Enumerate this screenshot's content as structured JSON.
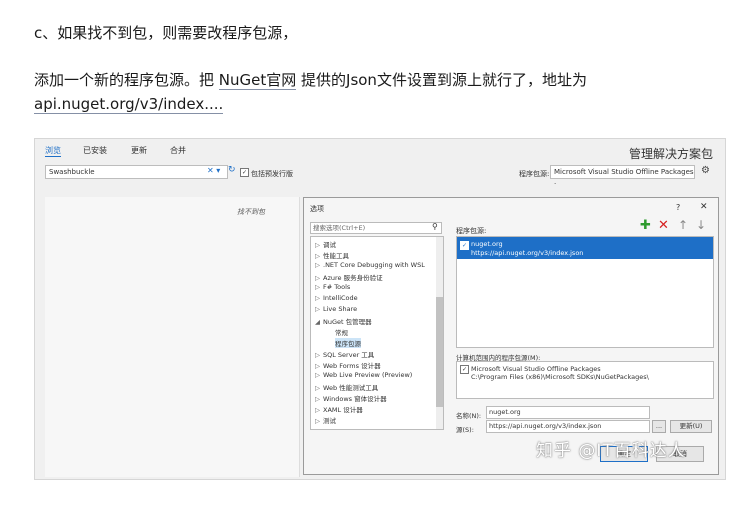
{
  "article": {
    "line1": "c、如果找不到包，则需要改程序包源，",
    "line2_prefix": "添加一个新的程序包源。把 ",
    "line2_link": "NuGet官网",
    "line2_suffix": " 提供的Json文件设置到源上就行了，地址为",
    "line3_link": "api.nuget.org/v3/index...."
  },
  "screenshot": {
    "tabs": [
      "浏览",
      "已安装",
      "更新",
      "合并"
    ],
    "manager_title": "管理解决方案包",
    "search_value": "Swashbuckle",
    "prerelease_label": "包括预发行版",
    "package_source_label": "程序包源:",
    "package_source_value": "Microsoft Visual Studio Offline Packages ·",
    "not_found": "找不到包",
    "dialog": {
      "title": "选项",
      "help": "?",
      "close": "✕",
      "search_placeholder": "搜索选项(Ctrl+E)",
      "tree": [
        {
          "label": "调试",
          "child": false
        },
        {
          "label": "性能工具",
          "child": false
        },
        {
          "label": ".NET Core Debugging with WSL",
          "child": false
        },
        {
          "label": "Azure 服务身份验证",
          "child": false
        },
        {
          "label": "F# Tools",
          "child": false
        },
        {
          "label": "IntelliCode",
          "child": false
        },
        {
          "label": "Live Share",
          "child": false
        },
        {
          "label": "NuGet 包管理器",
          "child": false,
          "expanded": true
        },
        {
          "label": "常规",
          "child": true
        },
        {
          "label": "程序包源",
          "child": true,
          "selected": true
        },
        {
          "label": "SQL Server 工具",
          "child": false
        },
        {
          "label": "Web Forms 设计器",
          "child": false
        },
        {
          "label": "Web Live Preview (Preview)",
          "child": false
        },
        {
          "label": "Web 性能测试工具",
          "child": false
        },
        {
          "label": "Windows 窗体设计器",
          "child": false
        },
        {
          "label": "XAML 设计器",
          "child": false
        },
        {
          "label": "测试",
          "child": false
        }
      ],
      "sources_label": "程序包源:",
      "source_name": "nuget.org",
      "source_url": "https://api.nuget.org/v3/index.json",
      "machine_label": "计算机范围内的程序包源(M):",
      "machine_name": "Microsoft Visual Studio Offline Packages",
      "machine_path": "C:\\Program Files (x86)\\Microsoft SDKs\\NuGetPackages\\",
      "name_label": "名称(N):",
      "name_value": "nuget.org",
      "src_label": "源(S):",
      "src_value": "https://api.nuget.org/v3/index.json",
      "dots": "...",
      "update": "更新(U)",
      "ok": "确定",
      "cancel": "取消"
    },
    "watermark": "知乎 @IT百科达人"
  }
}
